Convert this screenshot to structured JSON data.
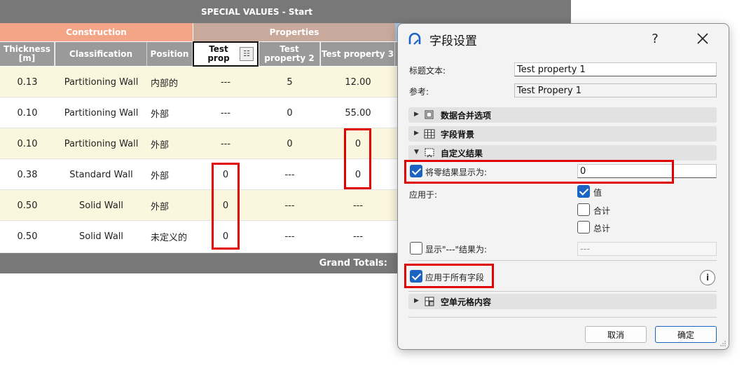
{
  "schedule": {
    "title": "SPECIAL VALUES - Start",
    "groups": {
      "construction": "Construction",
      "properties": "Properties"
    },
    "columns": [
      "Thickness [m]",
      "Classification",
      "Position",
      "Test prop",
      "Test property 2",
      "Test property 3"
    ],
    "rows": [
      {
        "thickness": "0.13",
        "classification": "Partitioning Wall",
        "position": "内部的",
        "p1": "---",
        "p2": "5",
        "p3": "12.00"
      },
      {
        "thickness": "0.10",
        "classification": "Partitioning Wall",
        "position": "外部",
        "p1": "---",
        "p2": "0",
        "p3": "55.00"
      },
      {
        "thickness": "0.10",
        "classification": "Partitioning Wall",
        "position": "外部",
        "p1": "---",
        "p2": "0",
        "p3": "0"
      },
      {
        "thickness": "0.38",
        "classification": "Standard Wall",
        "position": "外部",
        "p1": "0",
        "p2": "---",
        "p3": "0"
      },
      {
        "thickness": "0.50",
        "classification": "Solid Wall",
        "position": "外部",
        "p1": "0",
        "p2": "---",
        "p3": "---"
      },
      {
        "thickness": "0.50",
        "classification": "Solid Wall",
        "position": "未定义的",
        "p1": "0",
        "p2": "---",
        "p3": "---"
      }
    ],
    "grand_totals_label": "Grand Totals:"
  },
  "dialog": {
    "title": "字段设置",
    "help_icon": "?",
    "header_text_label": "标题文本:",
    "header_text_value": "Test property 1",
    "reference_label": "参考:",
    "reference_value": "Test Propery 1",
    "sections": {
      "merge": "数据合并选项",
      "background": "字段背景",
      "custom_result": "自定义结果",
      "empty_cell": "空单元格内容"
    },
    "show_zero_label": "将零结果显示为:",
    "show_zero_value": "0",
    "apply_to_label": "应用于:",
    "apply_options": [
      {
        "label": "值",
        "checked": true
      },
      {
        "label": "合计",
        "checked": false
      },
      {
        "label": "总计",
        "checked": false
      }
    ],
    "show_dash_label": "显示\"---\"结果为:",
    "show_dash_value": "---",
    "apply_all_label": "应用于所有字段",
    "info_icon": "i",
    "cancel_label": "取消",
    "ok_label": "确定",
    "accent_color": "#1c64c4",
    "highlight_color": "#e00000"
  }
}
